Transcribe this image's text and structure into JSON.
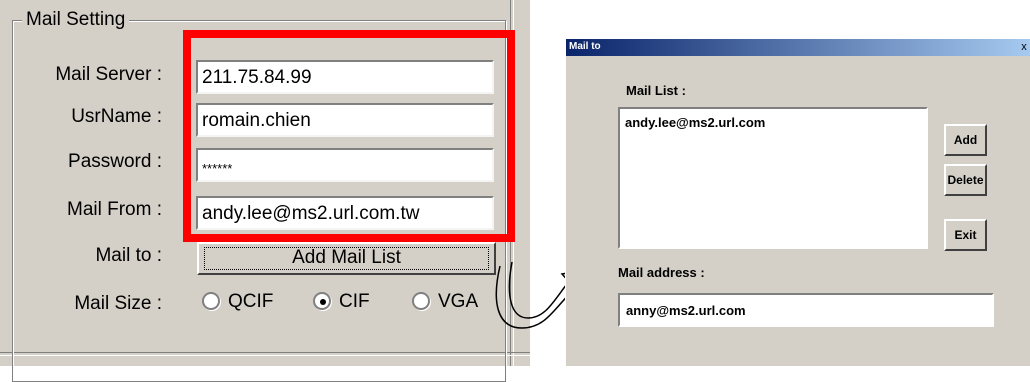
{
  "mail_setting": {
    "group_title": "Mail Setting",
    "mail_server": {
      "label": "Mail Server :",
      "value": "211.75.84.99"
    },
    "user_name": {
      "label": "UsrName :",
      "value": "romain.chien"
    },
    "password": {
      "label": "Password :",
      "value": "******"
    },
    "mail_from": {
      "label": "Mail From :",
      "value": "andy.lee@ms2.url.com.tw"
    },
    "mail_to": {
      "label": "Mail to :",
      "button_label": "Add Mail List"
    },
    "mail_size": {
      "label": "Mail Size :",
      "options": [
        "QCIF",
        "CIF",
        "VGA"
      ],
      "selected": "CIF"
    }
  },
  "mailto_dialog": {
    "title": "Mail to",
    "close_glyph": "x",
    "mail_list_label": "Mail List :",
    "mail_list_items": [
      "andy.lee@ms2.url.com"
    ],
    "add_label": "Add",
    "delete_label": "Delete",
    "exit_label": "Exit",
    "mail_address_label": "Mail address :",
    "mail_address_value": "anny@ms2.url.com"
  },
  "colors": {
    "highlight": "#ff0000",
    "panel_bg": "#d4d0c8",
    "titlebar_start": "#0a246a",
    "titlebar_end": "#a6caf0"
  }
}
